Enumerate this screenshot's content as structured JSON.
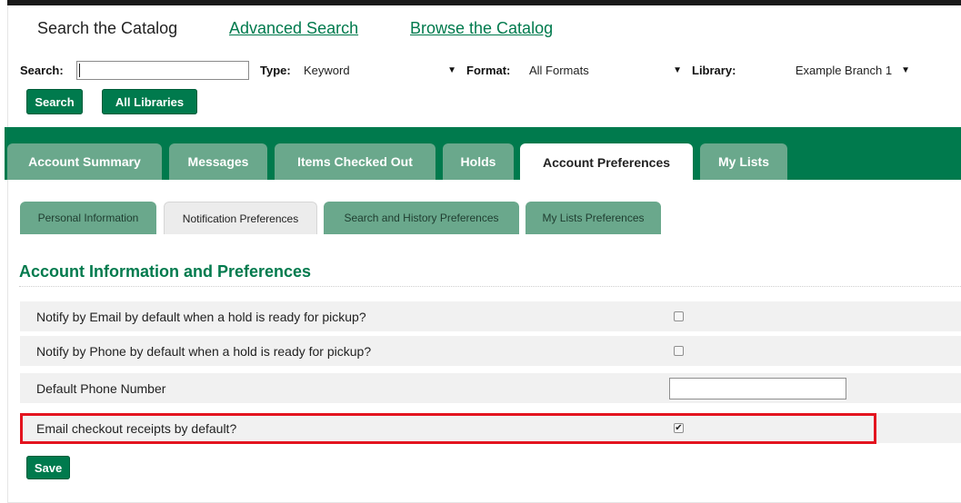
{
  "topnav": {
    "title": "Search the Catalog",
    "advanced": "Advanced Search",
    "browse": "Browse the Catalog"
  },
  "search": {
    "search_label": "Search:",
    "type_label": "Type:",
    "type_value": "Keyword",
    "format_label": "Format:",
    "format_value": "All Formats",
    "library_label": "Library:",
    "library_value": "Example Branch 1",
    "arrow": "▼",
    "search_button": "Search",
    "all_libraries_button": "All Libraries"
  },
  "tabs": [
    "Account Summary",
    "Messages",
    "Items Checked Out",
    "Holds",
    "Account Preferences",
    "My Lists"
  ],
  "active_tab": "Account Preferences",
  "subtabs": [
    "Personal Information",
    "Notification Preferences",
    "Search and History Preferences",
    "My Lists Preferences"
  ],
  "active_subtab": "Notification Preferences",
  "section_title": "Account Information and Preferences",
  "rows": [
    {
      "label": "Notify by Email by default when a hold is ready for pickup?",
      "type": "checkbox",
      "checked": false
    },
    {
      "label": "Notify by Phone by default when a hold is ready for pickup?",
      "type": "checkbox",
      "checked": false
    },
    {
      "label": "Default Phone Number",
      "type": "text",
      "value": ""
    },
    {
      "label": "Email checkout receipts by default?",
      "type": "checkbox",
      "checked": true
    }
  ],
  "checkmark": "✔",
  "save_button": "Save",
  "colors": {
    "brand": "#007a4d",
    "tab_inactive": "#6aa88c",
    "highlight": "#e3141f"
  }
}
